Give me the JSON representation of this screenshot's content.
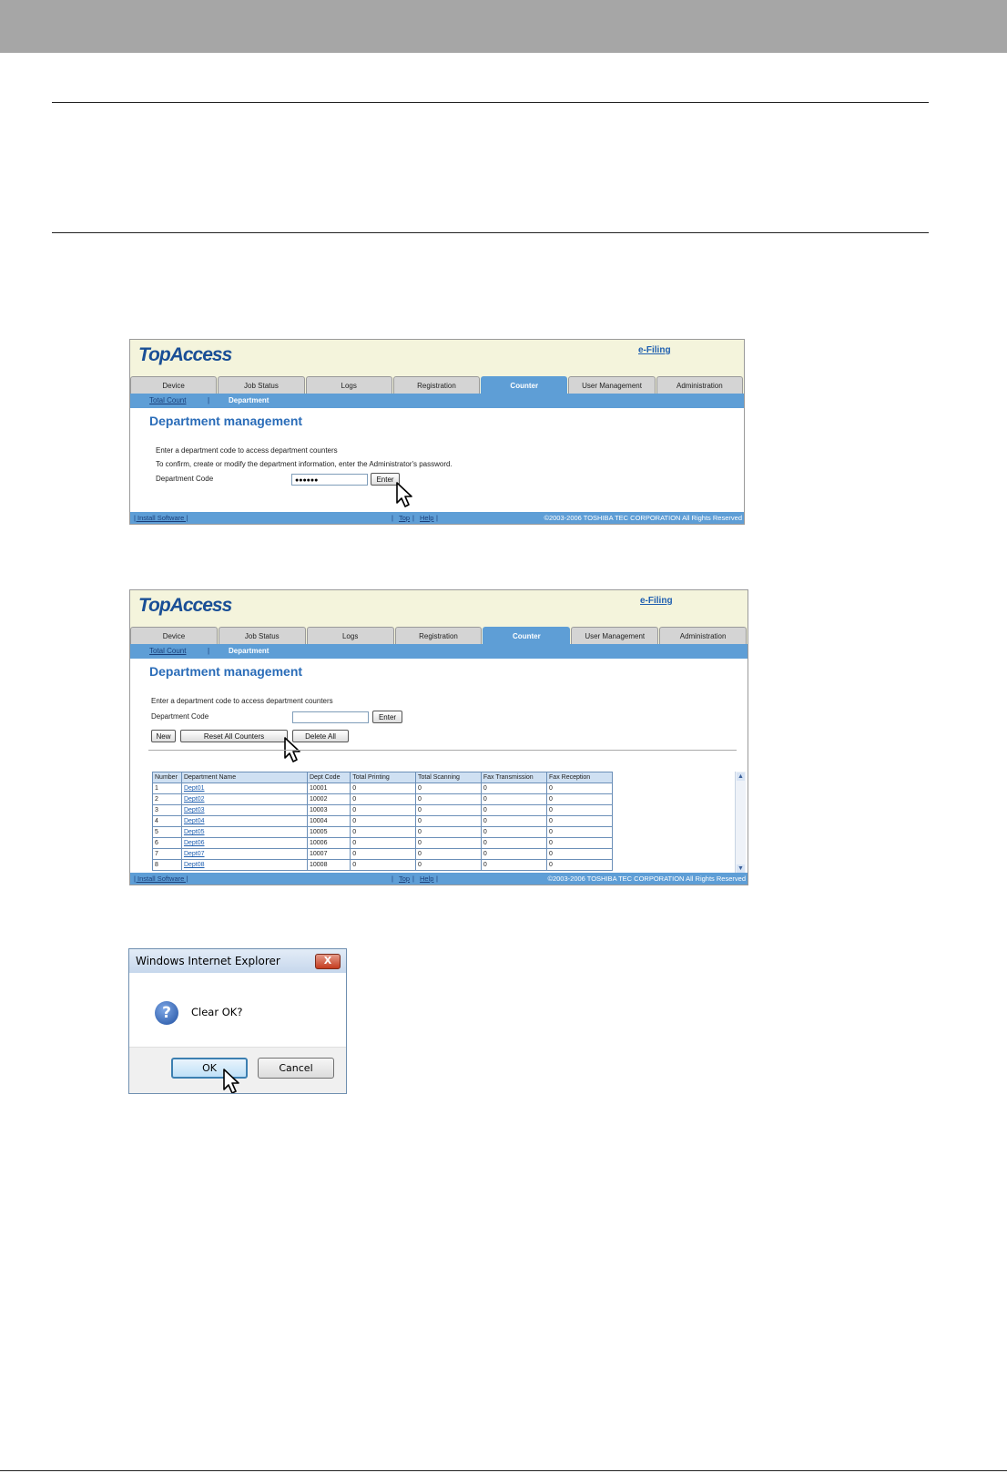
{
  "screen1": {
    "logo": "TopAccess",
    "efiling": "e-Filing",
    "tabs": [
      "Device",
      "Job Status",
      "Logs",
      "Registration",
      "Counter",
      "User Management",
      "Administration"
    ],
    "subnav": {
      "total_count": "Total Count",
      "separator": "|",
      "department": "Department"
    },
    "title": "Department management",
    "line1": "Enter a department code to access department counters",
    "line2": "To confirm, create or modify the department information, enter the Administrator's password.",
    "code_label": "Department Code",
    "code_value": "●●●●●●",
    "enter_label": "Enter",
    "footer": {
      "install": "| Install Software |",
      "top": "Top",
      "help": "Help",
      "bar1": "|",
      "bar2": "|",
      "bar3": "|",
      "copyright": "©2003-2006 TOSHIBA TEC CORPORATION All Rights Reserved"
    }
  },
  "screen2": {
    "logo": "TopAccess",
    "efiling": "e-Filing",
    "tabs": [
      "Device",
      "Job Status",
      "Logs",
      "Registration",
      "Counter",
      "User Management",
      "Administration"
    ],
    "subnav": {
      "total_count": "Total Count",
      "separator": "|",
      "department": "Department"
    },
    "title": "Department management",
    "line1": "Enter a department code to access department counters",
    "code_label": "Department Code",
    "code_value": "",
    "enter_label": "Enter",
    "new_label": "New",
    "reset_label": "Reset All Counters",
    "delete_label": "Delete All",
    "table": {
      "headers": [
        "Number",
        "Department Name",
        "Dept Code",
        "Total Printing",
        "Total Scanning",
        "Fax Transmission",
        "Fax Reception"
      ],
      "rows": [
        [
          "1",
          "Dept01",
          "10001",
          "0",
          "0",
          "0",
          "0"
        ],
        [
          "2",
          "Dept02",
          "10002",
          "0",
          "0",
          "0",
          "0"
        ],
        [
          "3",
          "Dept03",
          "10003",
          "0",
          "0",
          "0",
          "0"
        ],
        [
          "4",
          "Dept04",
          "10004",
          "0",
          "0",
          "0",
          "0"
        ],
        [
          "5",
          "Dept05",
          "10005",
          "0",
          "0",
          "0",
          "0"
        ],
        [
          "6",
          "Dept06",
          "10006",
          "0",
          "0",
          "0",
          "0"
        ],
        [
          "7",
          "Dept07",
          "10007",
          "0",
          "0",
          "0",
          "0"
        ],
        [
          "8",
          "Dept08",
          "10008",
          "0",
          "0",
          "0",
          "0"
        ]
      ]
    },
    "footer": {
      "install": "| Install Software |",
      "top": "Top",
      "help": "Help",
      "bar1": "|",
      "bar2": "|",
      "bar3": "|",
      "copyright": "©2003-2006 TOSHIBA TEC CORPORATION All Rights Reserved"
    }
  },
  "dialog": {
    "title": "Windows Internet Explorer",
    "close": "X",
    "icon": "question-icon",
    "icon_glyph": "?",
    "message": "Clear OK?",
    "ok_label": "OK",
    "cancel_label": "Cancel"
  },
  "colors": {
    "tab_active": "#5e9ed6",
    "header_bg": "#f4f4dc",
    "title_blue": "#2a6cb8",
    "top_band": "#a6a6a6"
  }
}
